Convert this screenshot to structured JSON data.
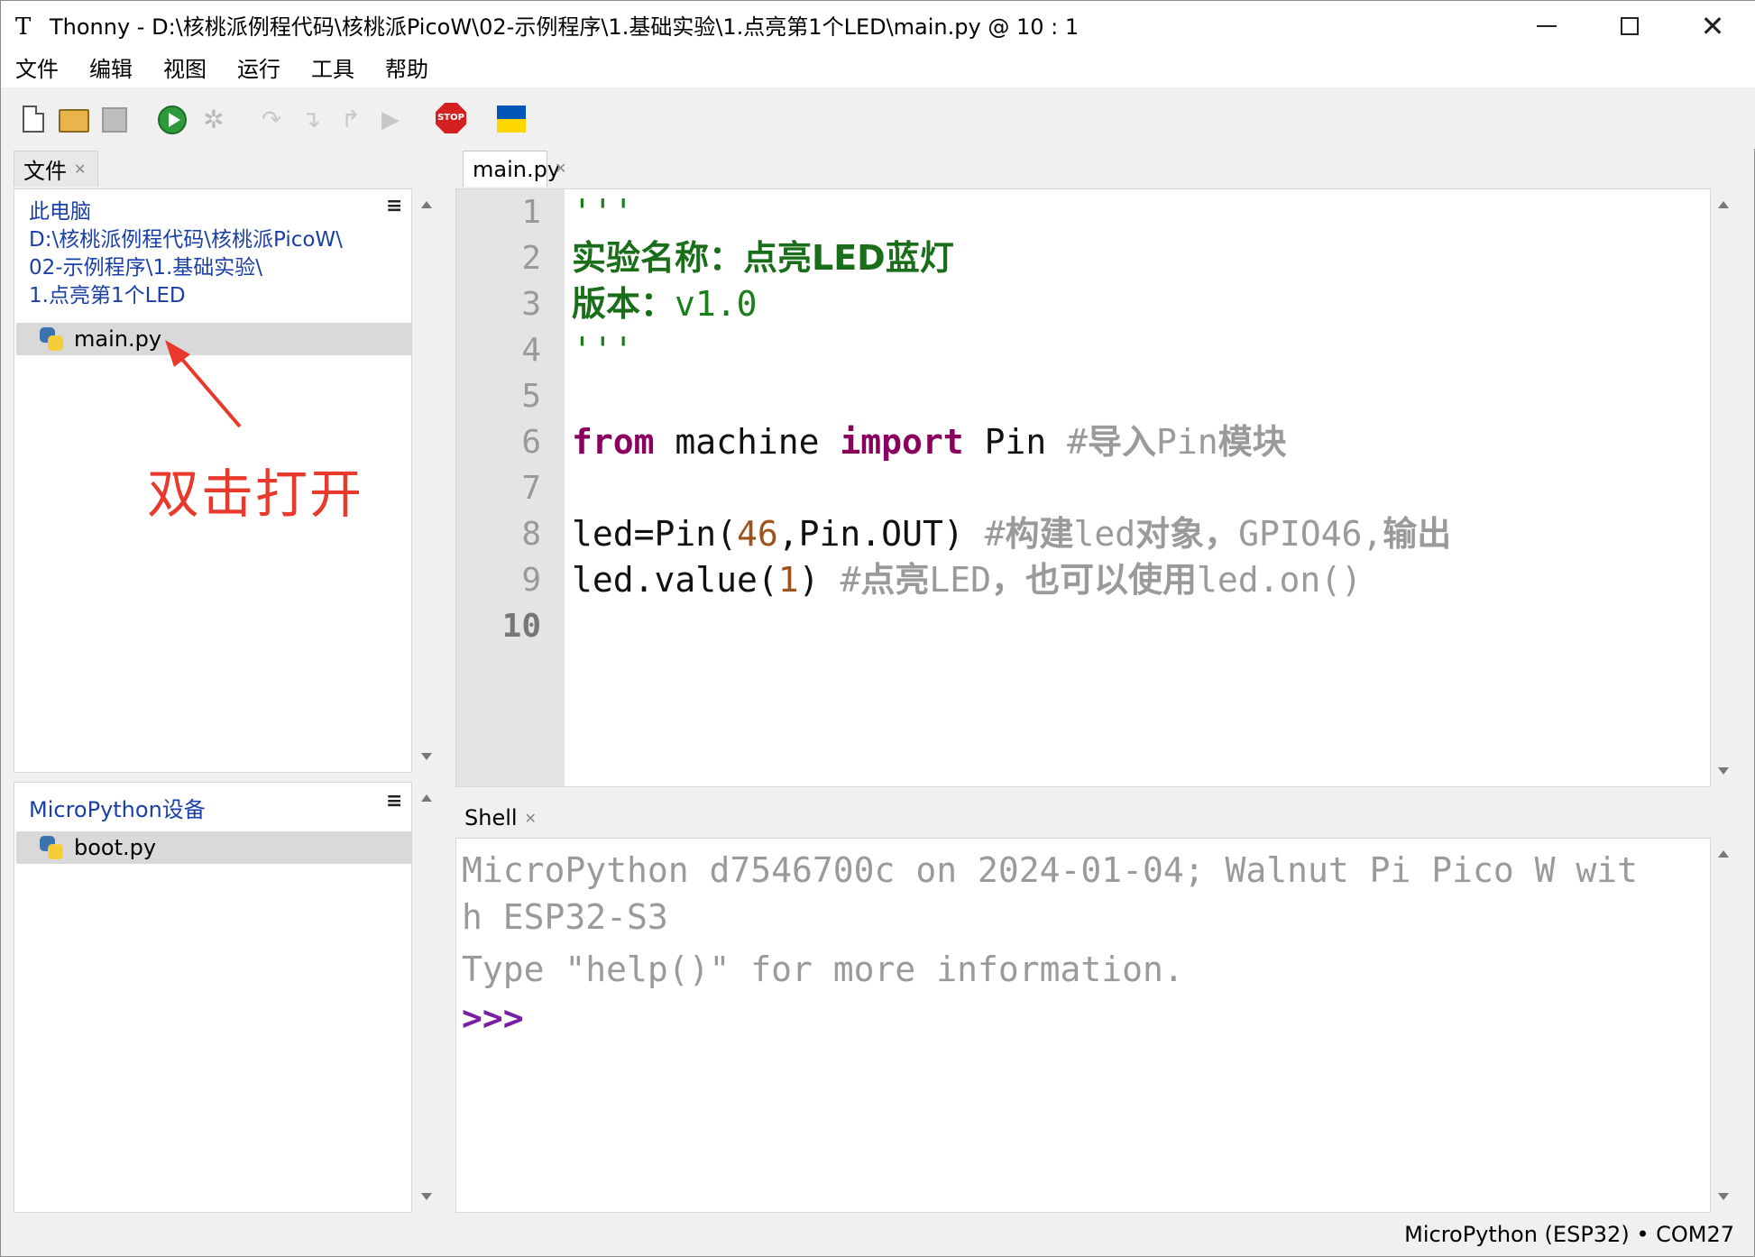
{
  "window": {
    "app_name": "Thonny",
    "title": "Thonny  -  D:\\核桃派例程代码\\核桃派PicoW\\02-示例程序\\1.基础实验\\1.点亮第1个LED\\main.py  @  10 : 1",
    "icons": {
      "minimize": "minimize-icon",
      "maximize": "maximize-icon",
      "close": "close-icon"
    }
  },
  "menu": [
    "文件",
    "编辑",
    "视图",
    "运行",
    "工具",
    "帮助"
  ],
  "toolbar": {
    "buttons": [
      "new-file-icon",
      "open-file-icon",
      "save-file-icon",
      "run-icon",
      "debug-icon",
      "step-over-icon",
      "step-into-icon",
      "step-out-icon",
      "resume-icon",
      "stop-icon",
      "ukraine-flag-icon"
    ],
    "stop_label": "STOP"
  },
  "files_panel": {
    "tab_label": "文件",
    "computer_label": "此电脑",
    "path_lines": [
      "D:\\核桃派例程代码\\核桃派PicoW\\",
      "02-示例程序\\1.基础实验\\",
      "1.点亮第1个LED"
    ],
    "files": [
      "main.py"
    ],
    "device_title": "MicroPython设备",
    "device_files": [
      "boot.py"
    ],
    "annotation": "双击打开"
  },
  "editor": {
    "tab_label": "main.py",
    "line_numbers": [
      "1",
      "2",
      "3",
      "4",
      "5",
      "6",
      "7",
      "8",
      "9",
      "10"
    ],
    "current_line": "10",
    "lines": {
      "l1": "'''",
      "l2": "实验名称：点亮LED蓝灯",
      "l3_a": "版本：",
      "l3_b": "v1.0",
      "l4": "'''",
      "l6_kw1": "from",
      "l6_mid": " machine ",
      "l6_kw2": "import",
      "l6_rest": " Pin ",
      "l6_com_a": "#",
      "l6_com_b": "导入",
      "l6_com_c": "Pin",
      "l6_com_d": "模块",
      "l8_a": "led=Pin(",
      "l8_num": "46",
      "l8_b": ",Pin.OUT) ",
      "l8_com_a": "#",
      "l8_com_b": "构建",
      "l8_com_c": "led",
      "l8_com_d": "对象，",
      "l8_com_e": "GPIO46,",
      "l8_com_f": "输出",
      "l9_a": "led.value(",
      "l9_num": "1",
      "l9_b": ") ",
      "l9_com_a": "#",
      "l9_com_b": "点亮",
      "l9_com_c": "LED",
      "l9_com_d": "，也可以使用",
      "l9_com_e": "led.on()"
    }
  },
  "shell": {
    "tab_label": "Shell",
    "line1": "MicroPython d7546700c on 2024-01-04; Walnut Pi Pico W wit",
    "line2": "h ESP32-S3",
    "line3": "Type \"help()\" for more information.",
    "prompt": ">>>"
  },
  "status": "MicroPython (ESP32)  •  COM27"
}
